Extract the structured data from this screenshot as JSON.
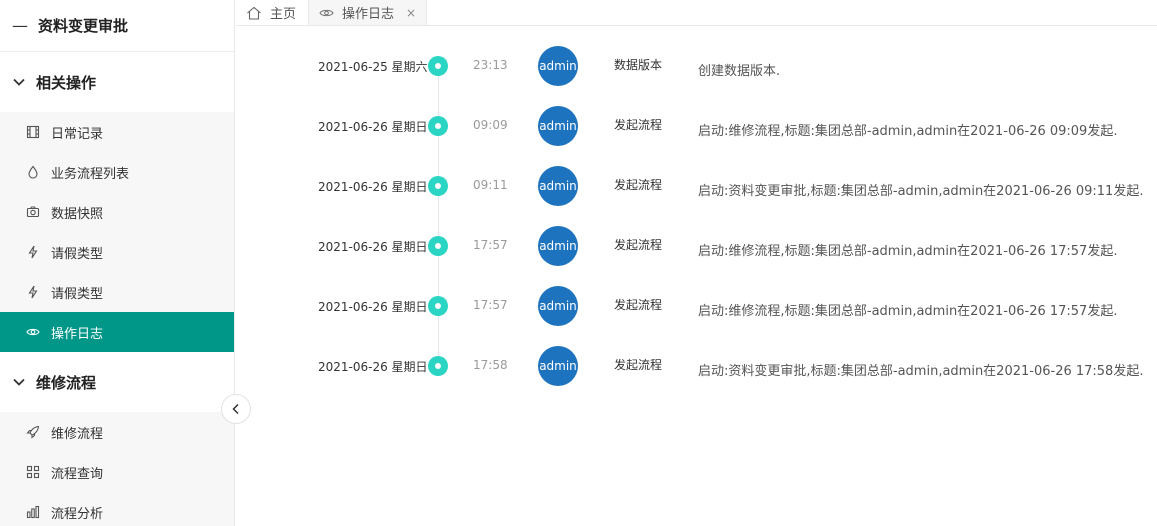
{
  "sidebar": {
    "header": {
      "dash": "—",
      "title": "资料变更审批"
    },
    "groups": [
      {
        "title": "相关操作",
        "items": [
          {
            "label": "日常记录",
            "icon": "film-icon"
          },
          {
            "label": "业务流程列表",
            "icon": "drop-icon"
          },
          {
            "label": "数据快照",
            "icon": "camera-icon"
          },
          {
            "label": "请假类型",
            "icon": "lightning-icon"
          },
          {
            "label": "请假类型",
            "icon": "lightning-icon"
          },
          {
            "label": "操作日志",
            "icon": "eye-icon",
            "active": true
          }
        ]
      },
      {
        "title": "维修流程",
        "items": [
          {
            "label": "维修流程",
            "icon": "rocket-icon"
          },
          {
            "label": "流程查询",
            "icon": "grid-icon"
          },
          {
            "label": "流程分析",
            "icon": "bar-chart-icon"
          }
        ]
      }
    ]
  },
  "tabs": [
    {
      "label": "主页",
      "icon": "home-icon"
    },
    {
      "label": "操作日志",
      "icon": "eye-icon",
      "close": "×",
      "active": true
    }
  ],
  "colors": {
    "accent": "#009688",
    "dot": "#2ad5c4",
    "avatar": "#1e73be"
  },
  "logs": [
    {
      "date": "2021-06-25 星期六",
      "time": "23:13",
      "user": "admin",
      "type": "数据版本",
      "desc": "创建数据版本."
    },
    {
      "date": "2021-06-26 星期日",
      "time": "09:09",
      "user": "admin",
      "type": "发起流程",
      "desc": "启动:维修流程,标题:集团总部-admin,admin在2021-06-26 09:09发起."
    },
    {
      "date": "2021-06-26 星期日",
      "time": "09:11",
      "user": "admin",
      "type": "发起流程",
      "desc": "启动:资料变更审批,标题:集团总部-admin,admin在2021-06-26 09:11发起."
    },
    {
      "date": "2021-06-26 星期日",
      "time": "17:57",
      "user": "admin",
      "type": "发起流程",
      "desc": "启动:维修流程,标题:集团总部-admin,admin在2021-06-26 17:57发起."
    },
    {
      "date": "2021-06-26 星期日",
      "time": "17:57",
      "user": "admin",
      "type": "发起流程",
      "desc": "启动:维修流程,标题:集团总部-admin,admin在2021-06-26 17:57发起."
    },
    {
      "date": "2021-06-26 星期日",
      "time": "17:58",
      "user": "admin",
      "type": "发起流程",
      "desc": "启动:资料变更审批,标题:集团总部-admin,admin在2021-06-26 17:58发起."
    }
  ]
}
